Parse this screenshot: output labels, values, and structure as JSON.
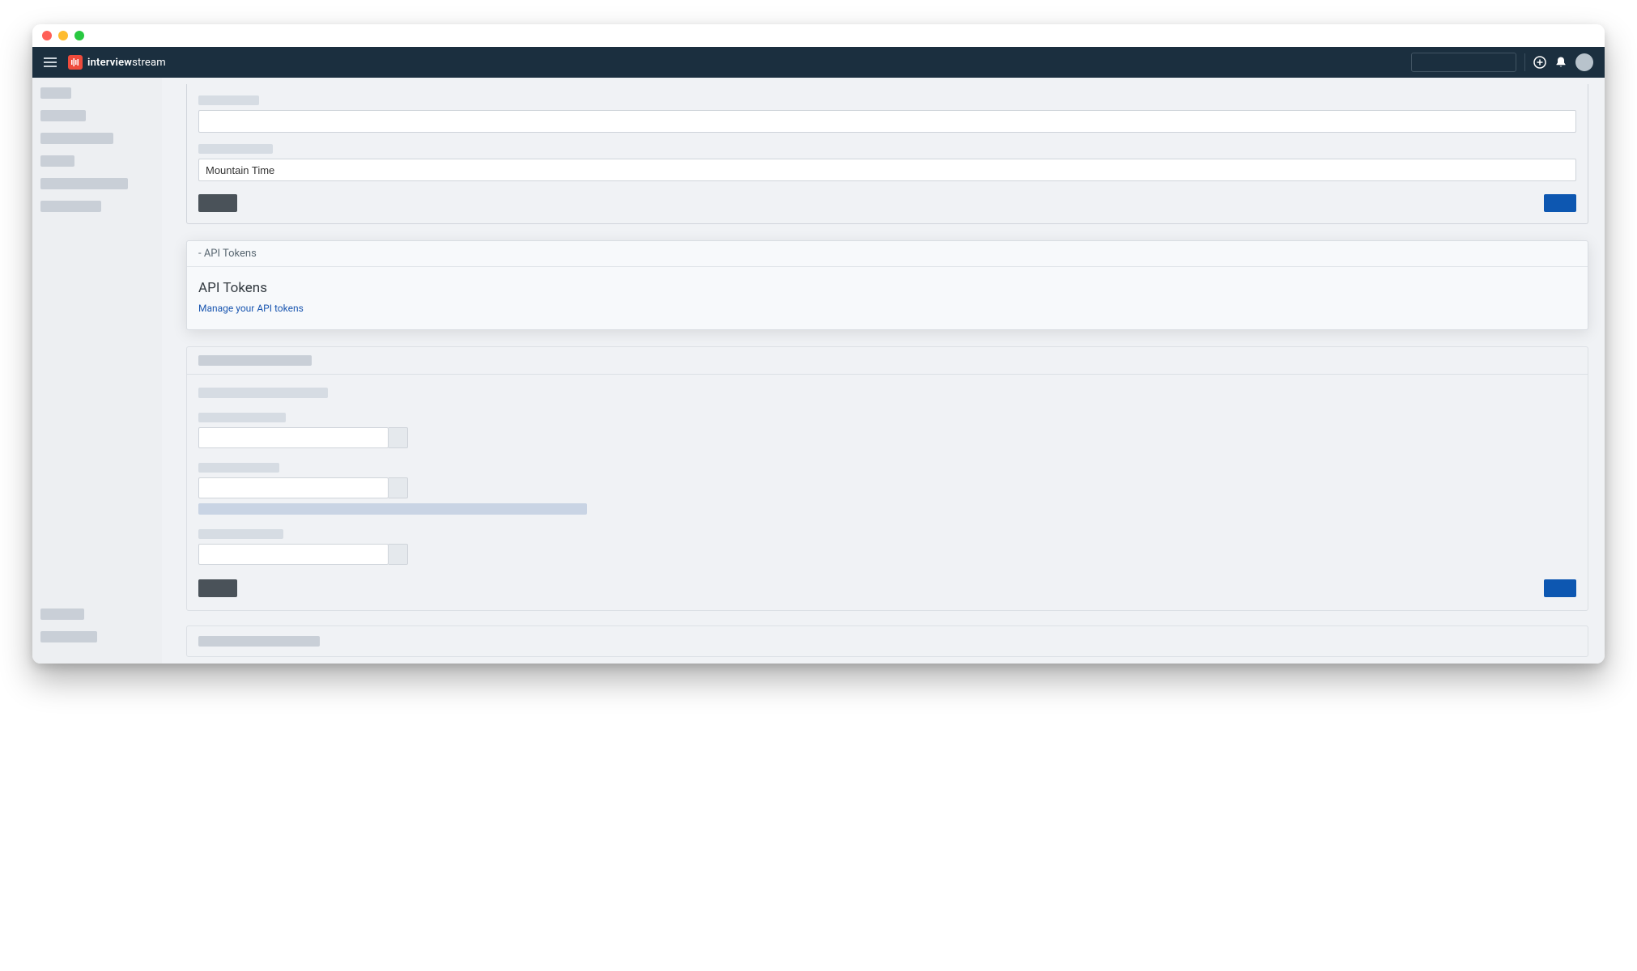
{
  "brand": {
    "name_part1": "interview",
    "name_part2": "stream"
  },
  "form1": {
    "timezone_value": "Mountain Time"
  },
  "api_tokens_card": {
    "header_prefix": "- API Tokens",
    "title": "API Tokens",
    "link": "Manage your API tokens"
  }
}
